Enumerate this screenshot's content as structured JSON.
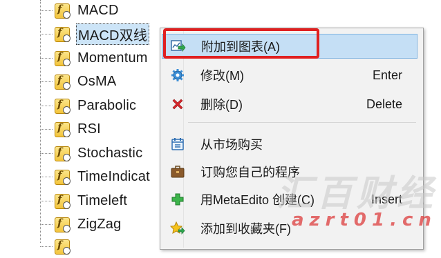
{
  "tree": {
    "items": [
      {
        "label": "MACD"
      },
      {
        "label": "MACD双线"
      },
      {
        "label": "Momentum"
      },
      {
        "label": "OsMA"
      },
      {
        "label": "Parabolic"
      },
      {
        "label": "RSI"
      },
      {
        "label": "Stochastic"
      },
      {
        "label": "TimeIndicat"
      },
      {
        "label": "Timeleft"
      },
      {
        "label": "ZigZag"
      }
    ]
  },
  "context_menu": {
    "items": [
      {
        "label": "附加到图表(A)",
        "shortcut": "",
        "icon": "attach-chart-icon"
      },
      {
        "label": "修改(M)",
        "shortcut": "Enter",
        "icon": "gear-icon"
      },
      {
        "label": "删除(D)",
        "shortcut": "Delete",
        "icon": "delete-x-icon"
      },
      {
        "label": "从市场购买",
        "shortcut": "",
        "icon": "market-icon"
      },
      {
        "label": "订购您自己的程序",
        "shortcut": "",
        "icon": "briefcase-icon"
      },
      {
        "label": "用MetaEdito 创建(C)",
        "shortcut": "Insert",
        "icon": "plus-icon"
      },
      {
        "label": "添加到收藏夹(F)",
        "shortcut": "",
        "icon": "star-icon"
      }
    ]
  },
  "watermark": {
    "text": "汇百财经",
    "url": "azrt01.cn"
  },
  "colors": {
    "highlight": "#c5dff5",
    "annotation_box": "#e02020"
  }
}
